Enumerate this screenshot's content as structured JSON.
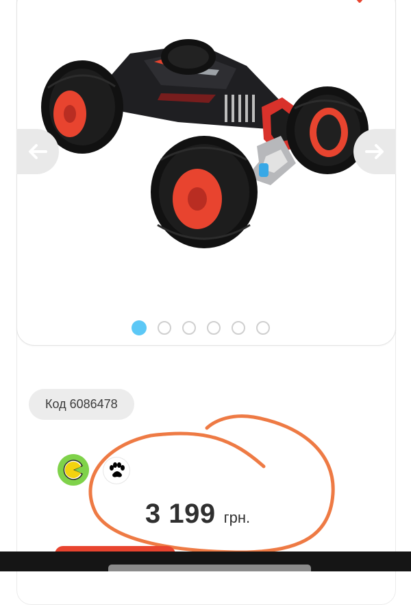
{
  "product": {
    "code_label": "Код 6086478",
    "price_amount": "3 199",
    "price_currency": "грн.",
    "image_icon": "rc-stunt-car-image"
  },
  "gallery": {
    "slide_count": 6,
    "active_slide": 1,
    "prev_icon": "arrow-left-icon",
    "next_icon": "arrow-right-icon",
    "dot_active_color": "#5cc8f6",
    "dot_inactive_color": "#cfcfcf"
  },
  "badges": [
    {
      "icon": "pacman-icon",
      "color": "#7fd24a"
    },
    {
      "icon": "paw-icon",
      "color": "#000000"
    }
  ],
  "annotation": {
    "shape": "hand-drawn-circle",
    "color": "#ee7a44"
  },
  "colors": {
    "accent": "#e8442f",
    "nav_bar": "#151515"
  }
}
